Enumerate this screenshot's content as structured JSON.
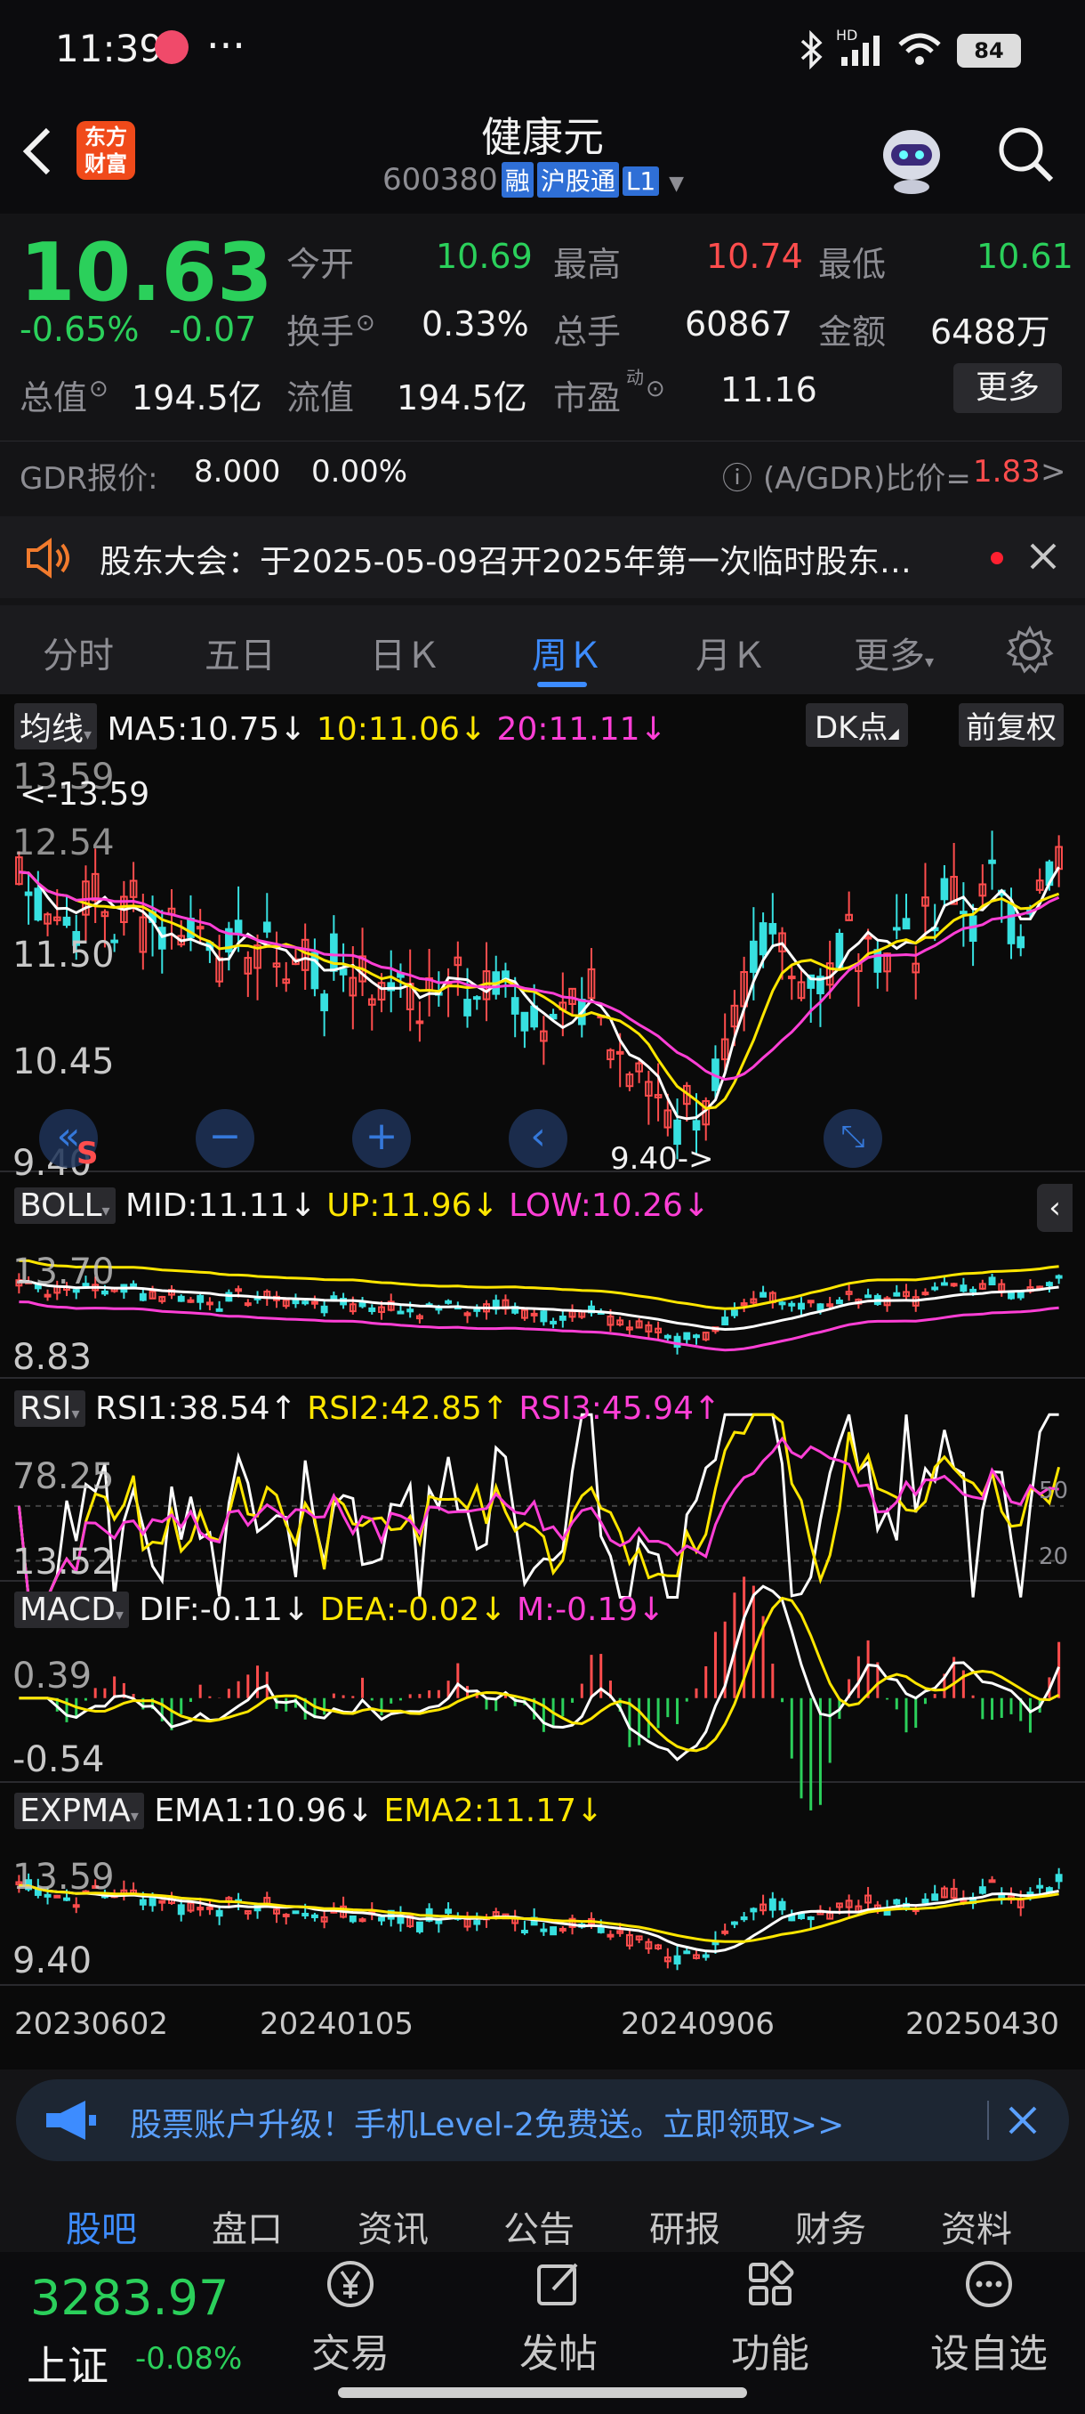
{
  "status_bar": {
    "time": "11:39",
    "more": "···",
    "battery": "84",
    "network": "HD"
  },
  "header": {
    "logo_line1": "东方",
    "logo_line2": "财富",
    "title": "健康元",
    "code": "600380",
    "tag_rong": "融",
    "tag_hgt": "沪股通",
    "tag_level": "L1"
  },
  "quote": {
    "price": "10.63",
    "change_pct": "-0.65%",
    "change": "-0.07",
    "open_label": "今开",
    "open": "10.69",
    "high_label": "最高",
    "high": "10.74",
    "low_label": "最低",
    "low": "10.61",
    "turnover_label": "换手",
    "turnover": "0.33%",
    "volume_label": "总手",
    "volume": "60867",
    "amount_label": "金额",
    "amount": "6488万",
    "mktcap_label": "总值",
    "mktcap": "194.5亿",
    "float_label": "流值",
    "float": "194.5亿",
    "pe_label": "市盈",
    "pe_sup": "动",
    "pe": "11.16",
    "more_label": "更多"
  },
  "gdr": {
    "label": "GDR报价:",
    "price": "8.000",
    "pct": "0.00%",
    "ratio_label": "(A/GDR)比价=",
    "ratio": "1.83",
    "arrow": ">"
  },
  "notice": {
    "text": "股东大会：于2025-05-09召开2025年第一次临时股东…"
  },
  "tabs": [
    {
      "label": "分时"
    },
    {
      "label": "五日"
    },
    {
      "label": "日Ｋ"
    },
    {
      "label": "周Ｋ"
    },
    {
      "label": "月Ｋ"
    },
    {
      "label": "更多"
    }
  ],
  "main_chart": {
    "indicator_btn": "均线",
    "ma5": "MA5:10.75↓",
    "ma10": "10:11.06↓",
    "ma20": "20:11.11↓",
    "dk_btn": "DK点",
    "adj_btn": "前复权",
    "axis": [
      "13.59",
      "12.54",
      "11.50",
      "10.45",
      "9.40"
    ],
    "max_label": "<-13.59",
    "min_label": "9.40->"
  },
  "boll": {
    "name": "BOLL",
    "mid": "MID:11.11↓",
    "up": "UP:11.96↓",
    "low": "LOW:10.26↓",
    "axis_top": "13.70",
    "axis_bot": "8.83"
  },
  "rsi": {
    "name": "RSI",
    "rsi1": "RSI1:38.54↑",
    "rsi2": "RSI2:42.85↑",
    "rsi3": "RSI3:45.94↑",
    "axis_top": "78.25",
    "axis_bot": "13.52",
    "ref50": "50",
    "ref20": "20"
  },
  "macd": {
    "name": "MACD",
    "dif": "DIF:-0.11↓",
    "dea": "DEA:-0.02↓",
    "m": "M:-0.19↓",
    "axis_top": "0.39",
    "axis_bot": "-0.54"
  },
  "expma": {
    "name": "EXPMA",
    "ema1": "EMA1:10.96↓",
    "ema2": "EMA2:11.17↓",
    "axis_top": "13.59",
    "axis_bot": "9.40"
  },
  "dates": [
    "20230602",
    "20240105",
    "20240906",
    "20250430"
  ],
  "promo": {
    "text": "股票账户升级！手机Level-2免费送。立即领取>>"
  },
  "bottom_tabs": [
    {
      "label": "股吧"
    },
    {
      "label": "盘口"
    },
    {
      "label": "资讯"
    },
    {
      "label": "公告"
    },
    {
      "label": "研报"
    },
    {
      "label": "财务"
    },
    {
      "label": "资料"
    }
  ],
  "footer": {
    "index_value": "3283.97",
    "index_name": "上证",
    "index_pct": "-0.08%",
    "trade": "交易",
    "post": "发帖",
    "func": "功能",
    "watch": "设自选"
  },
  "colors": {
    "up": "#ff4d4d",
    "down": "#2bd05b",
    "accent": "#3d8cff",
    "ma5": "#ffffff",
    "ma10": "#ffe600",
    "ma20": "#ff3fd6",
    "candle_down": "#37e0e0"
  }
}
